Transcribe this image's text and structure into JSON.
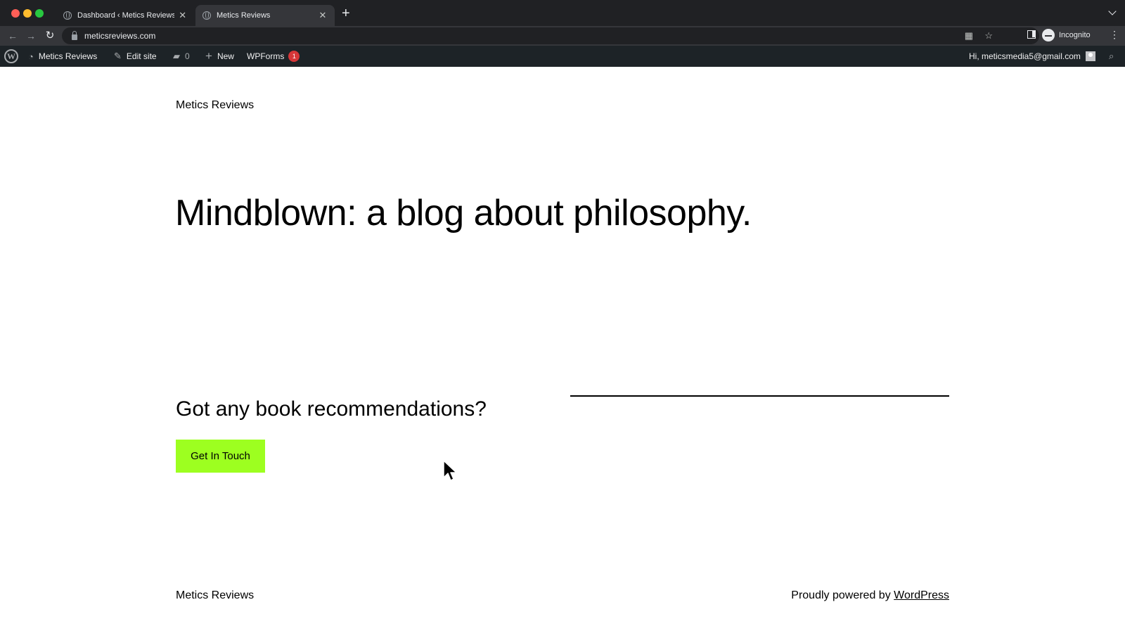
{
  "browser": {
    "tabs": [
      {
        "title": "Dashboard ‹ Metics Reviews —",
        "active": false
      },
      {
        "title": "Metics Reviews",
        "active": true
      }
    ],
    "url": "meticsreviews.com",
    "profile_label": "Incognito"
  },
  "admin_bar": {
    "site_name": "Metics Reviews",
    "edit_site": "Edit site",
    "comments_count": "0",
    "new_label": "New",
    "wpforms_label": "WPForms",
    "wpforms_badge": "1",
    "greeting": "Hi, meticsmedia5@gmail.com"
  },
  "page": {
    "site_title": "Metics Reviews",
    "hero_heading": "Mindblown: a blog about philosophy.",
    "cta_heading": "Got any book recommendations?",
    "cta_button": "Get In Touch",
    "cta_button_color": "#9dff20",
    "footer_site_title": "Metics Reviews",
    "footer_credit_prefix": "Proudly powered by",
    "footer_credit_link": "WordPress"
  },
  "icons": {
    "wp_logo": "W",
    "dashboard": "◔",
    "edit": "✎",
    "comment": "▰",
    "new": "+",
    "search": "⌕",
    "back": "←",
    "forward": "→",
    "reload": "↻",
    "star": "☆",
    "qr": "▦",
    "close": "✕",
    "new_tab": "+",
    "kebab": "⋮"
  }
}
